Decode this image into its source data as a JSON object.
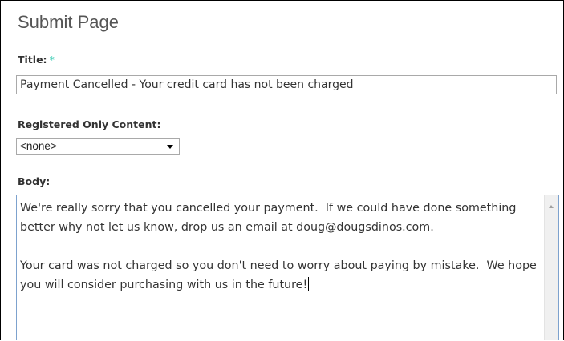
{
  "page": {
    "title": "Submit Page"
  },
  "form": {
    "title_field": {
      "label": "Title:",
      "required_marker": "*",
      "value": "Payment Cancelled - Your credit card has not been charged"
    },
    "registered_only": {
      "label": "Registered Only Content:",
      "selected": "<none>"
    },
    "body_field": {
      "label": "Body:",
      "value": "We're really sorry that you cancelled your payment.  If we could have done something better why not let us know, drop us an email at doug@dougsdinos.com.\n\nYour card was not charged so you don't need to worry about paying by mistake.  We hope you will consider purchasing with us in the future!"
    }
  },
  "colors": {
    "required": "#2fc9b0",
    "textarea_focus_border": "#7da2ce"
  }
}
